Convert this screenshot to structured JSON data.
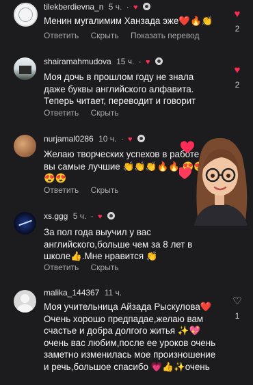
{
  "actions": {
    "reply": "Ответить",
    "hide": "Скрыть",
    "translate": "Показать перевод"
  },
  "comments": [
    {
      "username": "tilekberdievna_n",
      "time": "5 ч.",
      "text": "Менин мугалимим Ханзада эже❤️🔥👏",
      "likes": "2",
      "liked": true
    },
    {
      "username": "shairamahmudova",
      "time": "15 ч.",
      "text": "Моя дочь в прошлом году не знала даже буквы английского алфавита. Теперь читает, переводит и говорит",
      "likes": "2",
      "liked": true
    },
    {
      "username": "nurjamal0286",
      "time": "10 ч.",
      "text": "Желаю творческих успехов в работе вы самые лучшие 👏👏👏🔥🔥 😍😍😍😍",
      "likes": "",
      "liked": false
    },
    {
      "username": "xs.ggg",
      "time": "5 ч.",
      "text": "За пол года выучил у вас английского,больше чем за 8 лет в школе👍.Мне нравится 👏",
      "likes": "",
      "liked": false
    },
    {
      "username": "malika_144367",
      "time": "11 ч.",
      "text": "Моя учительница Айзада Рыскулова❤️ Очень хорошо предпадае,желаю вам счастье и добра долгого житья ✨💖 очень вас любим,после ее уроков очень заметно изменилась мое произношение и речь,большое спасибо 💗👍✨очень",
      "likes": "1",
      "liked": false
    }
  ],
  "icons": {
    "like": "heart-icon",
    "creator_badge": "heart-badge-icon"
  },
  "colors": {
    "background": "#1c1c1e",
    "accent": "#ff2d55"
  }
}
